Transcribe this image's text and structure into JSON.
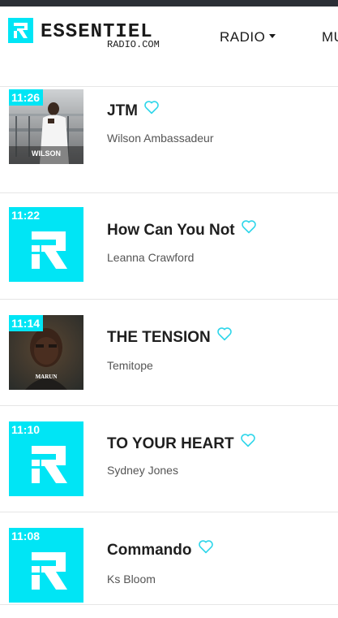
{
  "brand": {
    "logo_text": "ESSENTIEL",
    "logo_sub": "RADIO.COM",
    "accent_color": "#00e5f5"
  },
  "nav": {
    "items": [
      {
        "label": "RADIO",
        "has_dropdown": true
      },
      {
        "label": "MU"
      }
    ]
  },
  "tracks": [
    {
      "time": "11:26",
      "title": "JTM",
      "artist": "Wilson Ambassadeur",
      "art": "photo-wilson",
      "art_text": "WILSON"
    },
    {
      "time": "11:22",
      "title": "How Can You Not",
      "artist": "Leanna Crawford",
      "art": "brand-logo"
    },
    {
      "time": "11:14",
      "title": "THE TENSION",
      "artist": "Temitope",
      "art": "photo-marun",
      "art_text": "MARUN"
    },
    {
      "time": "11:10",
      "title": "TO YOUR HEART",
      "artist": "Sydney Jones",
      "art": "brand-logo"
    },
    {
      "time": "11:08",
      "title": "Commando",
      "artist": "Ks Bloom",
      "art": "brand-logo"
    }
  ],
  "icons": {
    "favorite": "heart-outline-icon",
    "dropdown": "caret-down-icon"
  }
}
